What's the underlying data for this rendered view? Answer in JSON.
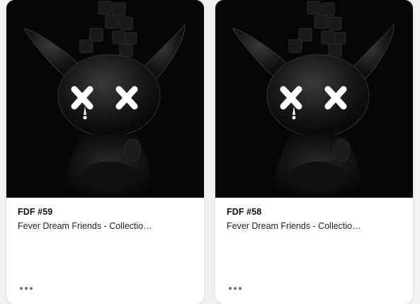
{
  "cards": [
    {
      "title": "FDF #59",
      "collection": "Fever Dream Friends - Collectio…",
      "menu_icon": "more-horizontal-icon"
    },
    {
      "title": "FDF #58",
      "collection": "Fever Dream Friends - Collectio…",
      "menu_icon": "more-horizontal-icon"
    }
  ],
  "colors": {
    "page_background": "#f2f2f4",
    "card_background": "#ffffff",
    "artwork_background": "#060606",
    "eye_color": "#ffffff",
    "menu_dots": "#6e6e78"
  }
}
